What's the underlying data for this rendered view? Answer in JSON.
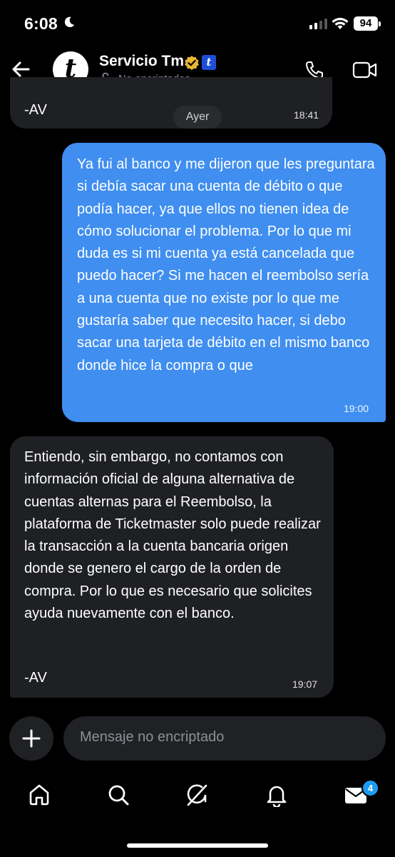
{
  "status_bar": {
    "time": "6:08",
    "battery": "94"
  },
  "header": {
    "contact_name": "Servicio Tm",
    "encryption_status": "No encriptados",
    "avatar_letter": "t",
    "badge_letter": "t"
  },
  "messages": {
    "previous": {
      "text": "-AV",
      "time": "18:41"
    },
    "date_separator": "Ayer",
    "outgoing": {
      "text": "Ya fui al banco y me dijeron que les preguntara si debía sacar una cuenta de débito o que podía hacer, ya que ellos no tienen idea de cómo solucionar el problema. Por lo que mi duda es si mi cuenta ya está cancelada que puedo hacer? Si me hacen el reembolso sería a una cuenta que no existe por lo que me gustaría saber que necesito hacer, si debo sacar una tarjeta de débito en el mismo banco donde hice la compra o que",
      "time": "19:00"
    },
    "incoming": {
      "text": "Entiendo, sin embargo, no contamos con información oficial de alguna alternativa de cuentas alternas para el Reembolso, la plataforma de Ticketmaster solo puede realizar la transacción a la cuenta bancaria origen donde se genero el cargo de la orden de compra. Por lo que es necesario que solicites ayuda nuevamente con el banco.",
      "signature": "-AV",
      "time": "19:07"
    }
  },
  "composer": {
    "placeholder": "Mensaje no encriptado"
  },
  "bottom_nav": {
    "items": [
      "home-icon",
      "search-icon",
      "grok-icon",
      "notifications-icon",
      "messages-icon"
    ],
    "messages_badge": "4"
  },
  "colors": {
    "accent": "#3f8ef0",
    "badge": "#1d9bf0",
    "bubble_incoming": "#1f2023"
  }
}
